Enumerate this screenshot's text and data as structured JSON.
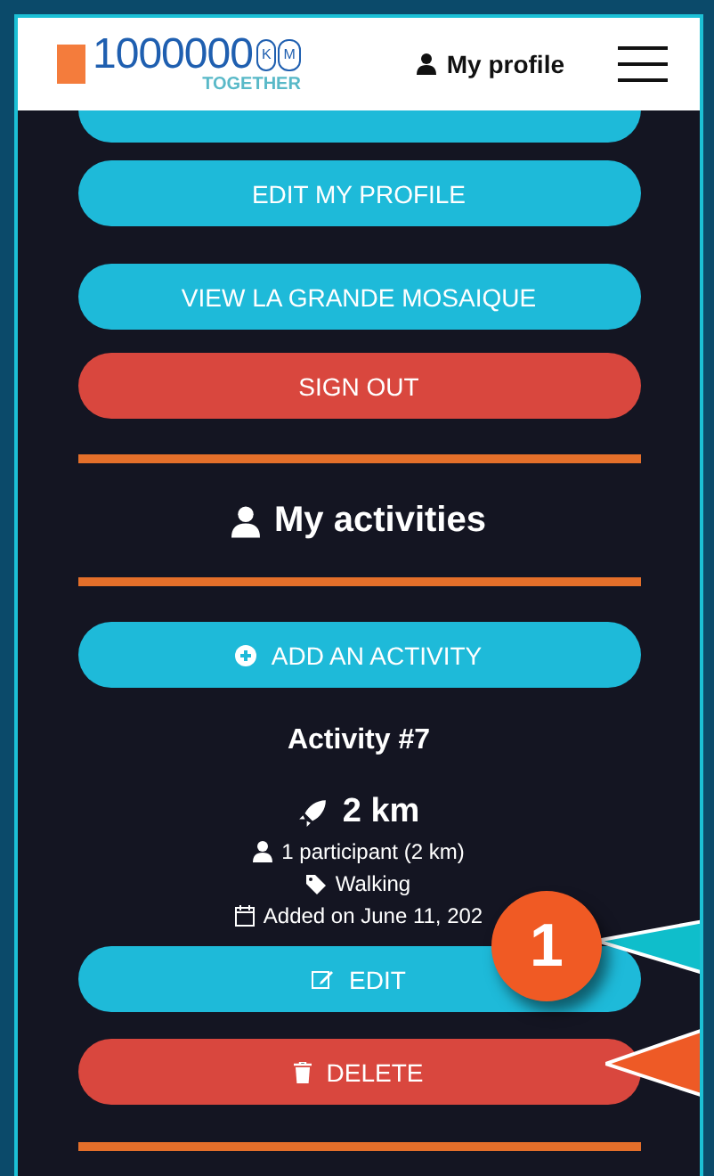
{
  "header": {
    "logo": {
      "number": "1000000",
      "unit_letters": [
        "K",
        "M"
      ],
      "tagline": "TOGETHER"
    },
    "profile_link": "My profile"
  },
  "account_buttons": [
    {
      "kind": "primary"
    },
    {
      "label": "EDIT MY PROFILE",
      "kind": "primary"
    },
    {
      "label": "VIEW LA GRANDE MOSAIQUE",
      "kind": "primary"
    },
    {
      "label": "SIGN OUT",
      "kind": "danger"
    }
  ],
  "activities": {
    "title": "My activities",
    "add_button": "ADD AN ACTIVITY",
    "items": [
      {
        "title": "Activity #7",
        "distance": "2 km",
        "participants": "1 participant (2 km)",
        "type": "Walking",
        "added": "Added on June 11, 202",
        "edit_button": "EDIT",
        "delete_button": "DELETE"
      }
    ]
  },
  "callout": {
    "number": "1"
  }
}
